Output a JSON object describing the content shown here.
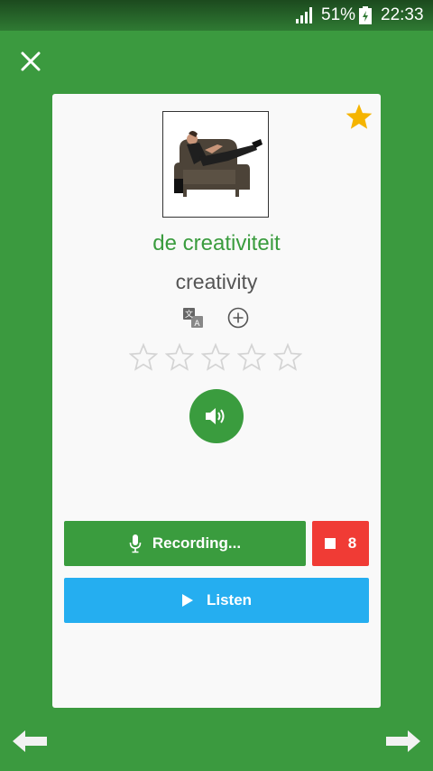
{
  "status_bar": {
    "battery": "51%",
    "time": "22:33"
  },
  "card": {
    "word": "de creativiteit",
    "translation": "creativity",
    "rating": {
      "max": 5,
      "value": 0
    },
    "favorite": true
  },
  "buttons": {
    "recording_label": "Recording...",
    "stop_count": "8",
    "listen_label": "Listen"
  },
  "colors": {
    "background": "#3b9a3f",
    "accent_green": "#3a9c3e",
    "stop_red": "#f03b35",
    "listen_blue": "#25aef0",
    "favorite_star": "#f5b400"
  }
}
